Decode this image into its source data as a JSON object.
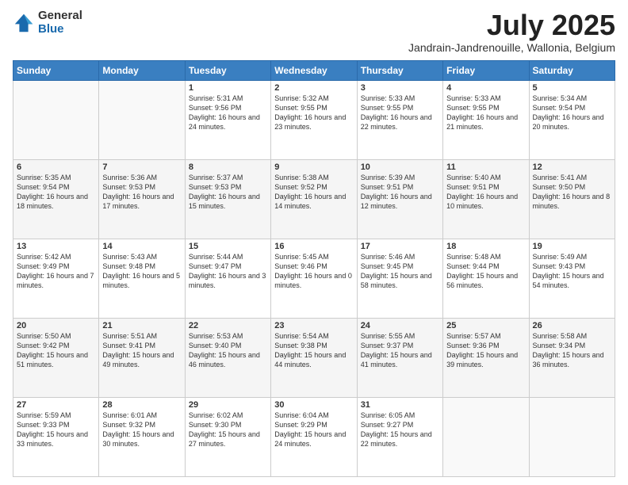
{
  "logo": {
    "general": "General",
    "blue": "Blue"
  },
  "title": "July 2025",
  "subtitle": "Jandrain-Jandrenouille, Wallonia, Belgium",
  "days_of_week": [
    "Sunday",
    "Monday",
    "Tuesday",
    "Wednesday",
    "Thursday",
    "Friday",
    "Saturday"
  ],
  "weeks": [
    [
      {
        "day": "",
        "info": ""
      },
      {
        "day": "",
        "info": ""
      },
      {
        "day": "1",
        "info": "Sunrise: 5:31 AM\nSunset: 9:56 PM\nDaylight: 16 hours and 24 minutes."
      },
      {
        "day": "2",
        "info": "Sunrise: 5:32 AM\nSunset: 9:55 PM\nDaylight: 16 hours and 23 minutes."
      },
      {
        "day": "3",
        "info": "Sunrise: 5:33 AM\nSunset: 9:55 PM\nDaylight: 16 hours and 22 minutes."
      },
      {
        "day": "4",
        "info": "Sunrise: 5:33 AM\nSunset: 9:55 PM\nDaylight: 16 hours and 21 minutes."
      },
      {
        "day": "5",
        "info": "Sunrise: 5:34 AM\nSunset: 9:54 PM\nDaylight: 16 hours and 20 minutes."
      }
    ],
    [
      {
        "day": "6",
        "info": "Sunrise: 5:35 AM\nSunset: 9:54 PM\nDaylight: 16 hours and 18 minutes."
      },
      {
        "day": "7",
        "info": "Sunrise: 5:36 AM\nSunset: 9:53 PM\nDaylight: 16 hours and 17 minutes."
      },
      {
        "day": "8",
        "info": "Sunrise: 5:37 AM\nSunset: 9:53 PM\nDaylight: 16 hours and 15 minutes."
      },
      {
        "day": "9",
        "info": "Sunrise: 5:38 AM\nSunset: 9:52 PM\nDaylight: 16 hours and 14 minutes."
      },
      {
        "day": "10",
        "info": "Sunrise: 5:39 AM\nSunset: 9:51 PM\nDaylight: 16 hours and 12 minutes."
      },
      {
        "day": "11",
        "info": "Sunrise: 5:40 AM\nSunset: 9:51 PM\nDaylight: 16 hours and 10 minutes."
      },
      {
        "day": "12",
        "info": "Sunrise: 5:41 AM\nSunset: 9:50 PM\nDaylight: 16 hours and 8 minutes."
      }
    ],
    [
      {
        "day": "13",
        "info": "Sunrise: 5:42 AM\nSunset: 9:49 PM\nDaylight: 16 hours and 7 minutes."
      },
      {
        "day": "14",
        "info": "Sunrise: 5:43 AM\nSunset: 9:48 PM\nDaylight: 16 hours and 5 minutes."
      },
      {
        "day": "15",
        "info": "Sunrise: 5:44 AM\nSunset: 9:47 PM\nDaylight: 16 hours and 3 minutes."
      },
      {
        "day": "16",
        "info": "Sunrise: 5:45 AM\nSunset: 9:46 PM\nDaylight: 16 hours and 0 minutes."
      },
      {
        "day": "17",
        "info": "Sunrise: 5:46 AM\nSunset: 9:45 PM\nDaylight: 15 hours and 58 minutes."
      },
      {
        "day": "18",
        "info": "Sunrise: 5:48 AM\nSunset: 9:44 PM\nDaylight: 15 hours and 56 minutes."
      },
      {
        "day": "19",
        "info": "Sunrise: 5:49 AM\nSunset: 9:43 PM\nDaylight: 15 hours and 54 minutes."
      }
    ],
    [
      {
        "day": "20",
        "info": "Sunrise: 5:50 AM\nSunset: 9:42 PM\nDaylight: 15 hours and 51 minutes."
      },
      {
        "day": "21",
        "info": "Sunrise: 5:51 AM\nSunset: 9:41 PM\nDaylight: 15 hours and 49 minutes."
      },
      {
        "day": "22",
        "info": "Sunrise: 5:53 AM\nSunset: 9:40 PM\nDaylight: 15 hours and 46 minutes."
      },
      {
        "day": "23",
        "info": "Sunrise: 5:54 AM\nSunset: 9:38 PM\nDaylight: 15 hours and 44 minutes."
      },
      {
        "day": "24",
        "info": "Sunrise: 5:55 AM\nSunset: 9:37 PM\nDaylight: 15 hours and 41 minutes."
      },
      {
        "day": "25",
        "info": "Sunrise: 5:57 AM\nSunset: 9:36 PM\nDaylight: 15 hours and 39 minutes."
      },
      {
        "day": "26",
        "info": "Sunrise: 5:58 AM\nSunset: 9:34 PM\nDaylight: 15 hours and 36 minutes."
      }
    ],
    [
      {
        "day": "27",
        "info": "Sunrise: 5:59 AM\nSunset: 9:33 PM\nDaylight: 15 hours and 33 minutes."
      },
      {
        "day": "28",
        "info": "Sunrise: 6:01 AM\nSunset: 9:32 PM\nDaylight: 15 hours and 30 minutes."
      },
      {
        "day": "29",
        "info": "Sunrise: 6:02 AM\nSunset: 9:30 PM\nDaylight: 15 hours and 27 minutes."
      },
      {
        "day": "30",
        "info": "Sunrise: 6:04 AM\nSunset: 9:29 PM\nDaylight: 15 hours and 24 minutes."
      },
      {
        "day": "31",
        "info": "Sunrise: 6:05 AM\nSunset: 9:27 PM\nDaylight: 15 hours and 22 minutes."
      },
      {
        "day": "",
        "info": ""
      },
      {
        "day": "",
        "info": ""
      }
    ]
  ]
}
